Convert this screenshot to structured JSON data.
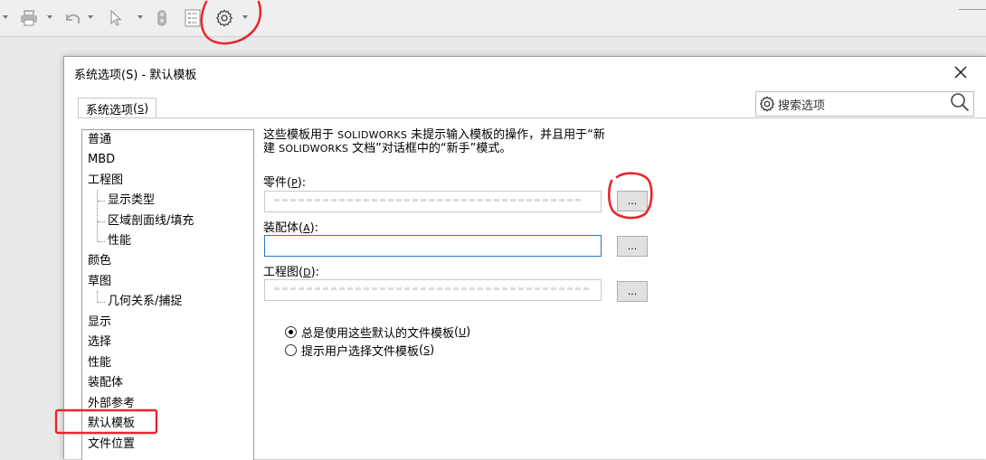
{
  "dialog": {
    "title": "系统选项(S) - 默认模板",
    "tab": {
      "label": "系统选项",
      "mnemonic": "S"
    },
    "search_placeholder": "搜索选项"
  },
  "tree": [
    {
      "label": "普通",
      "level": 0
    },
    {
      "label": "MBD",
      "level": 0
    },
    {
      "label": "工程图",
      "level": 0
    },
    {
      "label": "显示类型",
      "level": 1
    },
    {
      "label": "区域剖面线/填充",
      "level": 1
    },
    {
      "label": "性能",
      "level": 1
    },
    {
      "label": "颜色",
      "level": 0
    },
    {
      "label": "草图",
      "level": 0
    },
    {
      "label": "几何关系/捕捉",
      "level": 1
    },
    {
      "label": "显示",
      "level": 0
    },
    {
      "label": "选择",
      "level": 0
    },
    {
      "label": "性能",
      "level": 0
    },
    {
      "label": "装配体",
      "level": 0
    },
    {
      "label": "外部参考",
      "level": 0
    },
    {
      "label": "默认模板",
      "level": 0,
      "selected": true
    },
    {
      "label": "文件位置",
      "level": 0
    }
  ],
  "description": {
    "line1_a": "这些模板用于 ",
    "line1_sw": "SOLIDWORKS",
    "line1_b": " 未提示输入模板的操作，并且用于“新",
    "line2_a": "建 ",
    "line2_sw": "SOLIDWORKS",
    "line2_b": " 文档”对话框中的“新手”模式。"
  },
  "templates": {
    "part": {
      "label": "零件",
      "mnemonic": "P"
    },
    "assembly": {
      "label": "装配体",
      "mnemonic": "A"
    },
    "drawing": {
      "label": "工程图",
      "mnemonic": "D"
    },
    "browse_label": "..."
  },
  "options": {
    "always_use": {
      "label": "总是使用这些默认的文件模板",
      "mnemonic": "U",
      "checked": true
    },
    "prompt_user": {
      "label": "提示用户选择文件模板",
      "mnemonic": "S",
      "checked": false
    }
  },
  "colors": {
    "annotation": "#e8262a",
    "field_focus": "#2b78c5"
  },
  "icons": {
    "toolbar": [
      "print-icon",
      "undo-icon",
      "select-arrow-icon",
      "traffic-light-icon",
      "file-properties-icon",
      "options-gear-icon"
    ]
  }
}
